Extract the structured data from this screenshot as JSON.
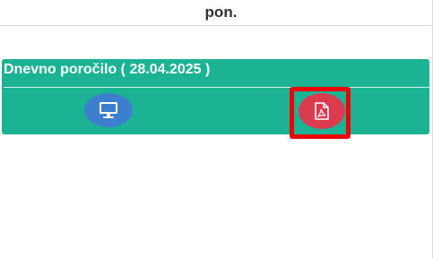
{
  "header": {
    "day_label": "pon."
  },
  "report": {
    "title": "Dnevno poročilo ( 28.04.2025 )",
    "buttons": {
      "screen_icon": "monitor-icon",
      "pdf_icon": "pdf-file-icon"
    }
  },
  "colors": {
    "card_background": "#1cb394",
    "screen_button": "#3d7fcf",
    "pdf_button": "#dc3a4e",
    "highlight": "#ee0000"
  }
}
